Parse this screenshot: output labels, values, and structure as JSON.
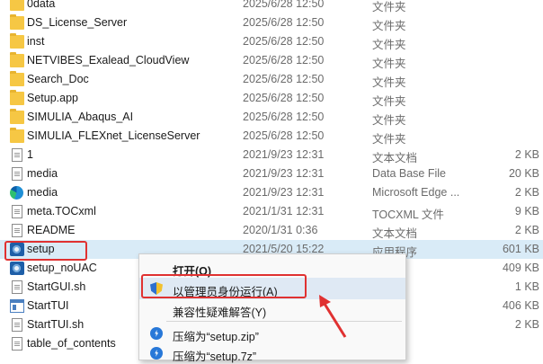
{
  "files": [
    {
      "name": "0data",
      "date": "2025/6/28 12:50",
      "type": "文件夹",
      "size": "",
      "icon": "folder-icon"
    },
    {
      "name": "DS_License_Server",
      "date": "2025/6/28 12:50",
      "type": "文件夹",
      "size": "",
      "icon": "folder-icon"
    },
    {
      "name": "inst",
      "date": "2025/6/28 12:50",
      "type": "文件夹",
      "size": "",
      "icon": "folder-icon"
    },
    {
      "name": "NETVIBES_Exalead_CloudView",
      "date": "2025/6/28 12:50",
      "type": "文件夹",
      "size": "",
      "icon": "folder-icon"
    },
    {
      "name": "Search_Doc",
      "date": "2025/6/28 12:50",
      "type": "文件夹",
      "size": "",
      "icon": "folder-icon"
    },
    {
      "name": "Setup.app",
      "date": "2025/6/28 12:50",
      "type": "文件夹",
      "size": "",
      "icon": "folder-icon"
    },
    {
      "name": "SIMULIA_Abaqus_AI",
      "date": "2025/6/28 12:50",
      "type": "文件夹",
      "size": "",
      "icon": "folder-icon"
    },
    {
      "name": "SIMULIA_FLEXnet_LicenseServer",
      "date": "2025/6/28 12:50",
      "type": "文件夹",
      "size": "",
      "icon": "folder-icon"
    },
    {
      "name": "1",
      "date": "2021/9/23 12:31",
      "type": "文本文档",
      "size": "2 KB",
      "icon": "document-icon"
    },
    {
      "name": "media",
      "date": "2021/9/23 12:31",
      "type": "Data Base File",
      "size": "20 KB",
      "icon": "document-icon"
    },
    {
      "name": "media",
      "date": "2021/9/23 12:31",
      "type": "Microsoft Edge ...",
      "size": "2 KB",
      "icon": "edge-icon"
    },
    {
      "name": "meta.TOCxml",
      "date": "2021/1/31 12:31",
      "type": "TOCXML 文件",
      "size": "9 KB",
      "icon": "document-icon"
    },
    {
      "name": "README",
      "date": "2020/1/31 0:36",
      "type": "文本文档",
      "size": "2 KB",
      "icon": "document-icon"
    },
    {
      "name": "setup",
      "date": "2021/5/20 15:22",
      "type": "应用程序",
      "size": "601 KB",
      "icon": "setup-app-icon"
    },
    {
      "name": "setup_noUAC",
      "date": "",
      "type": "",
      "size": "409 KB",
      "icon": "setup-app-icon"
    },
    {
      "name": "StartGUI.sh",
      "date": "",
      "type": "",
      "size": "1 KB",
      "icon": "document-icon"
    },
    {
      "name": "StartTUI",
      "date": "",
      "type": "",
      "size": "406 KB",
      "icon": "window-app-icon"
    },
    {
      "name": "StartTUI.sh",
      "date": "",
      "type": "",
      "size": "2 KB",
      "icon": "document-icon"
    },
    {
      "name": "table_of_contents",
      "date": "",
      "type": "",
      "size": "",
      "icon": "document-icon"
    }
  ],
  "context_menu": {
    "open": "打开(O)",
    "run_as_admin": "以管理员身份运行(A)",
    "compat": "兼容性疑难解答(Y)",
    "zip": "压缩为“setup.zip”",
    "sevenzip": "压缩为“setup.7z”"
  },
  "colors": {
    "highlight": "#e03131",
    "selection": "#d9ebf7",
    "folder": "#f6c744"
  }
}
